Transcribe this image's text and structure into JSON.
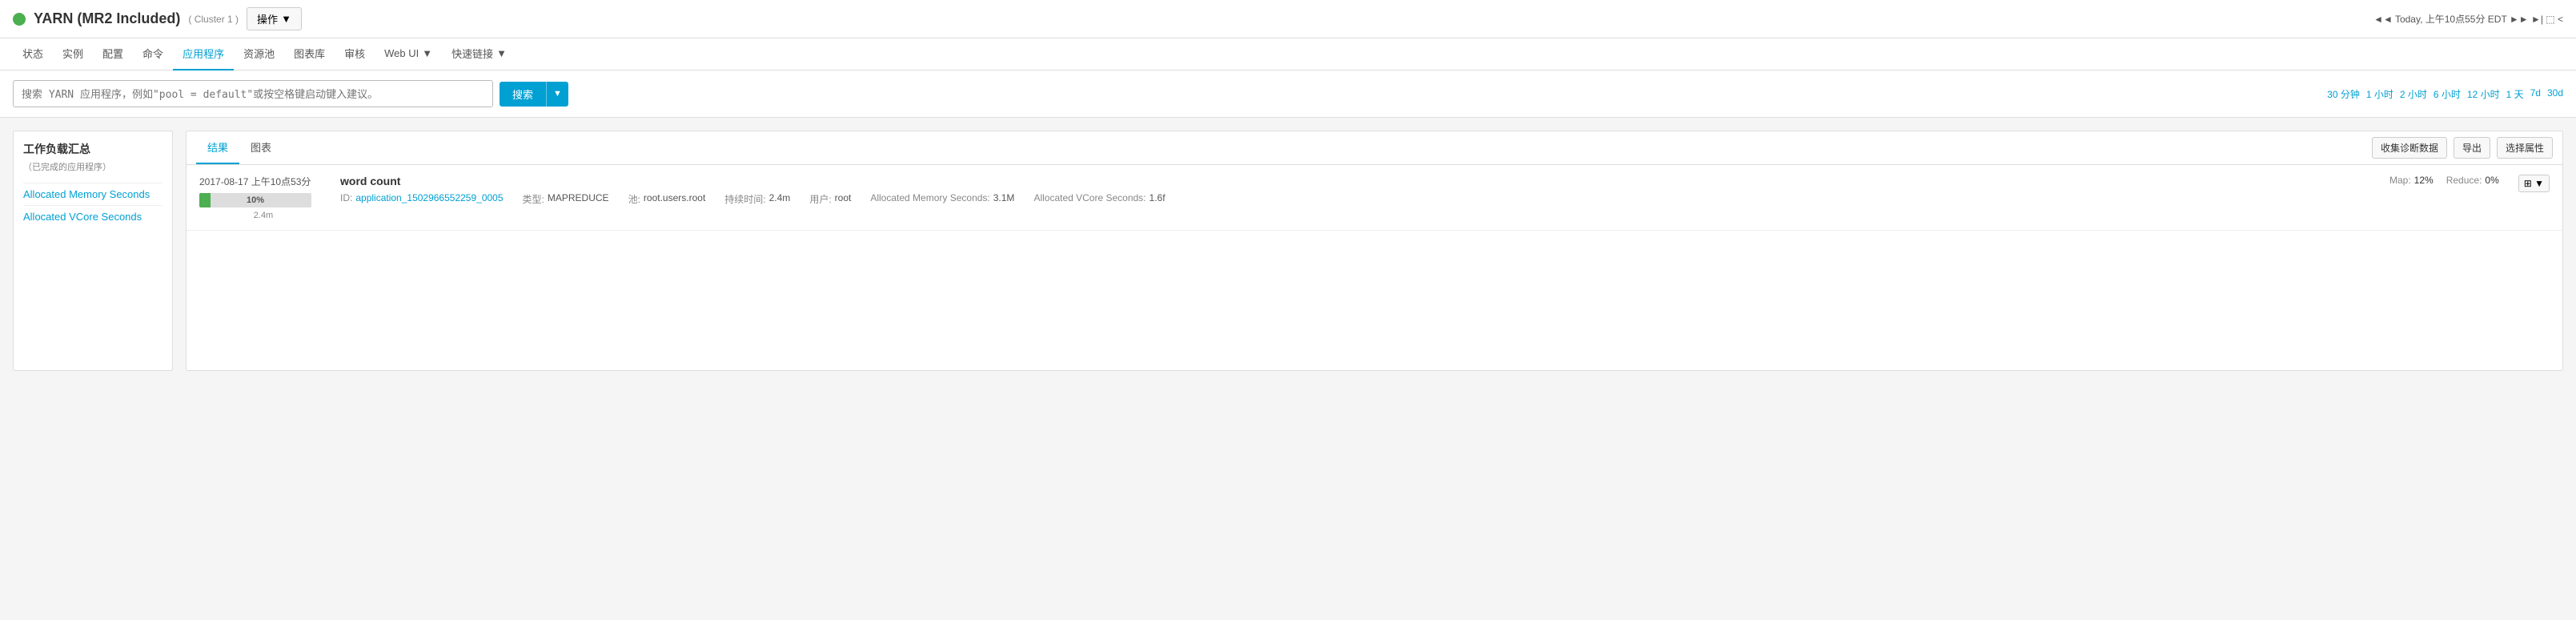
{
  "header": {
    "dot_color": "#4caf50",
    "title": "YARN (MR2 Included)",
    "cluster": "( Cluster 1 )",
    "ops_button": "操作",
    "ops_arrow": "▼",
    "time_info": "◄◄ Today, 上午10点55分 EDT ►► ►| ⬚ <"
  },
  "nav": {
    "items": [
      {
        "label": "状态",
        "active": false
      },
      {
        "label": "实例",
        "active": false
      },
      {
        "label": "配置",
        "active": false
      },
      {
        "label": "命令",
        "active": false
      },
      {
        "label": "应用程序",
        "active": true
      },
      {
        "label": "资源池",
        "active": false
      },
      {
        "label": "图表库",
        "active": false
      },
      {
        "label": "审核",
        "active": false
      },
      {
        "label": "Web UI",
        "active": false,
        "has_arrow": true
      },
      {
        "label": "快速链接",
        "active": false,
        "has_arrow": true
      }
    ]
  },
  "search": {
    "placeholder": "搜索 YARN 应用程序，例如\"pool = default\"或按空格键启动键入建议。",
    "button_label": "搜索",
    "button_arrow": "▼",
    "time_filters": [
      "30 分钟",
      "1 小时",
      "2 小时",
      "6 小时",
      "12 小时",
      "1 天",
      "7d",
      "30d"
    ]
  },
  "sidebar": {
    "title": "工作负载汇总",
    "subtitle": "（已完成的应用程序）",
    "items": [
      {
        "label": "Allocated Memory Seconds"
      },
      {
        "label": "Allocated VCore Seconds"
      }
    ]
  },
  "results": {
    "tabs": [
      {
        "label": "结果",
        "active": true
      },
      {
        "label": "图表",
        "active": false
      }
    ],
    "action_buttons": [
      "收集诊断数据",
      "导出",
      "选择属性"
    ],
    "cards": [
      {
        "date": "2017-08-17 上午10点53分",
        "progress_percent": 10,
        "progress_label": "10%",
        "duration": "2.4m",
        "app_name": "word count",
        "id_label": "ID:",
        "id_value": "application_1502966552259_0005",
        "type_label": "类型:",
        "type_value": "MAPREDUCE",
        "pool_label": "池:",
        "pool_value": "root.users.root",
        "duration_label": "持续时间:",
        "duration_value": "2.4m",
        "user_label": "用户:",
        "user_value": "root",
        "alloc_mem_label": "Allocated Memory Seconds:",
        "alloc_mem_value": "3.1M",
        "alloc_vcores_label": "Allocated VCore Seconds:",
        "alloc_vcores_value": "1.6f",
        "map_label": "Map:",
        "map_value": "12%",
        "reduce_label": "Reduce:",
        "reduce_value": "0%"
      }
    ]
  }
}
